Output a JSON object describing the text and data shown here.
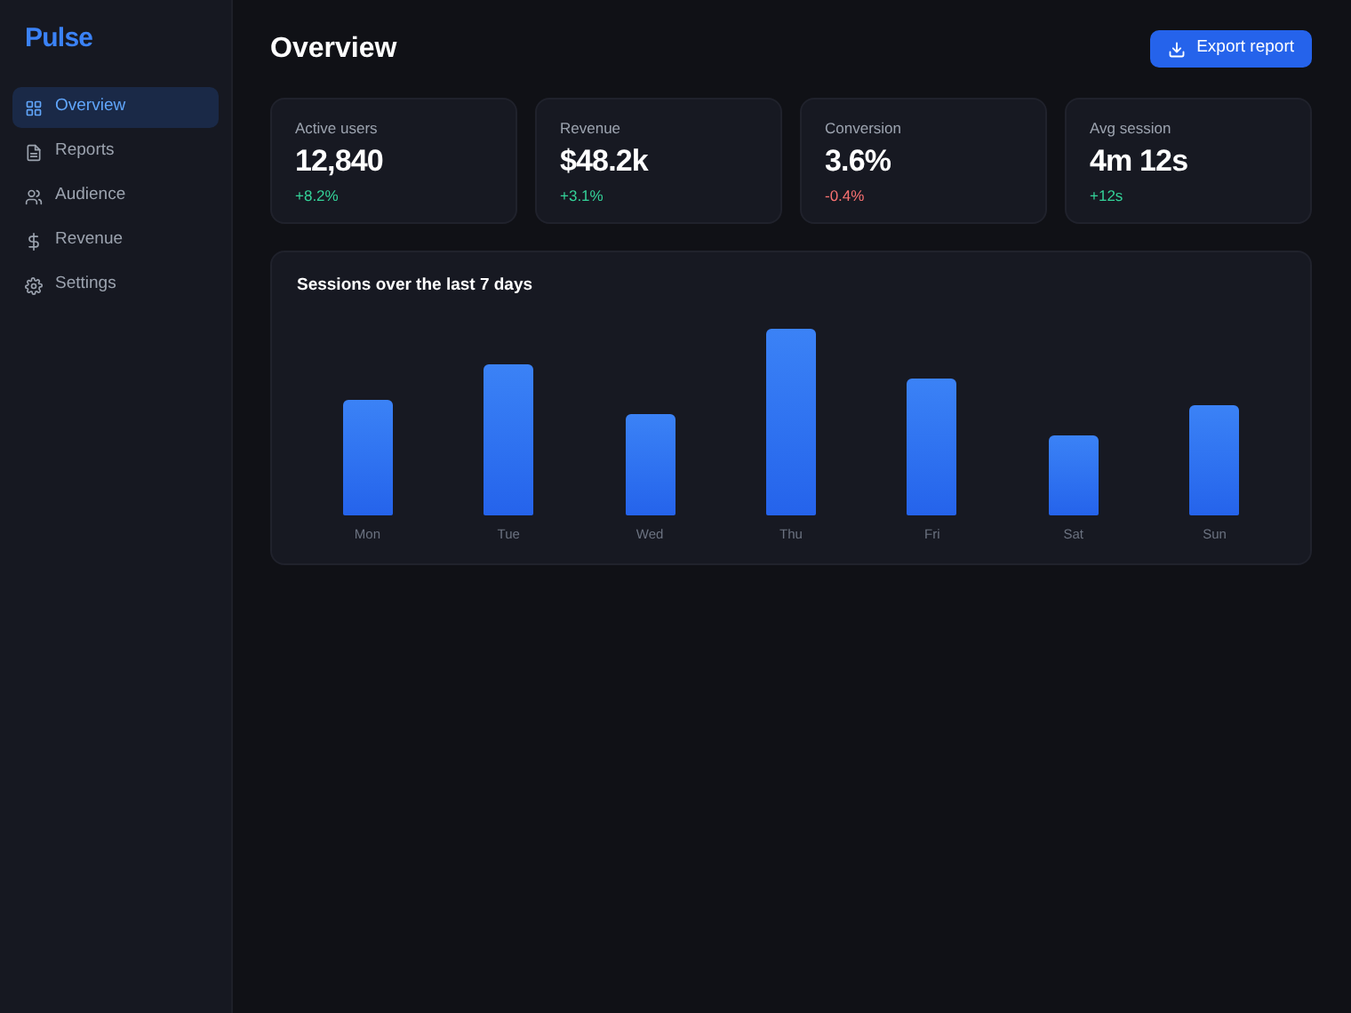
{
  "sidebar": {
    "logo": "Pulse",
    "items": [
      {
        "label": "Overview",
        "selected": true
      },
      {
        "label": "Reports",
        "selected": false
      },
      {
        "label": "Audience",
        "selected": false
      },
      {
        "label": "Revenue",
        "selected": false
      },
      {
        "label": "Settings",
        "selected": false
      }
    ]
  },
  "header": {
    "title": "Overview",
    "export_button": "Export report"
  },
  "stats": [
    {
      "label": "Active users",
      "value": "12,840",
      "change": "+8.2%",
      "color": "#34d399"
    },
    {
      "label": "Revenue",
      "value": "$48.2k",
      "change": "+3.1%",
      "color": "#34d399"
    },
    {
      "label": "Conversion",
      "value": "3.6%",
      "change": "-0.4%",
      "color": "#f87171"
    },
    {
      "label": "Avg session",
      "value": "4m 12s",
      "change": "+12s",
      "color": "#34d399"
    }
  ],
  "sessions_panel": {
    "title": "Sessions over the last 7 days",
    "days": [
      {
        "label": "Mon"
      },
      {
        "label": "Tue"
      },
      {
        "label": "Wed"
      },
      {
        "label": "Thu"
      },
      {
        "label": "Fri"
      },
      {
        "label": "Sat"
      },
      {
        "label": "Sun"
      }
    ]
  }
}
